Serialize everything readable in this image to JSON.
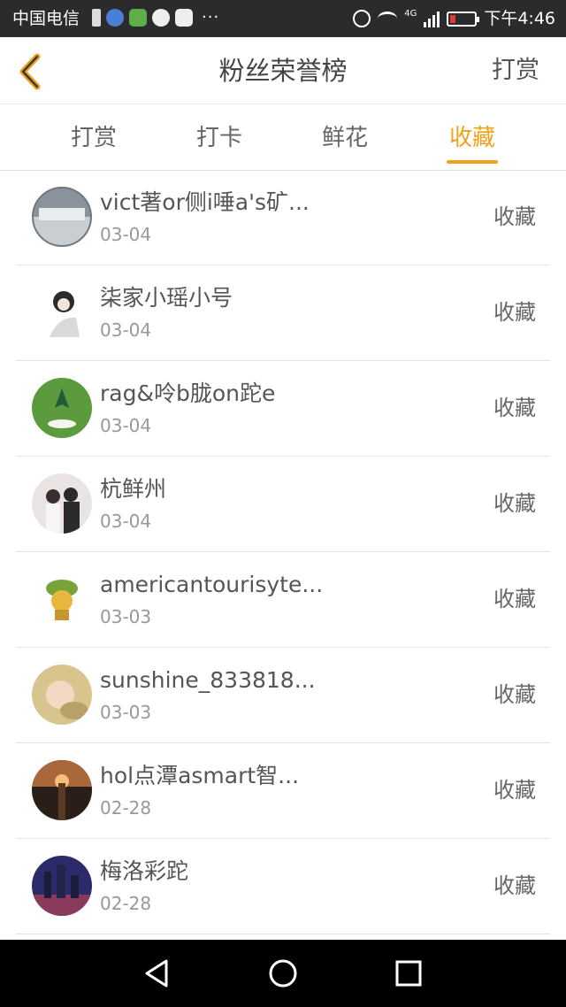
{
  "status_bar": {
    "carrier": "中国电信",
    "more": "···",
    "network": "4G",
    "time": "下午4:46"
  },
  "header": {
    "title": "粉丝荣誉榜",
    "action": "打赏",
    "accent_color": "#f0a11d"
  },
  "tabs": [
    {
      "label": "打赏",
      "active": false
    },
    {
      "label": "打卡",
      "active": false
    },
    {
      "label": "鲜花",
      "active": false
    },
    {
      "label": "收藏",
      "active": true
    }
  ],
  "rows": [
    {
      "name": "vict著or侧i唾a's矿...",
      "date": "03-04",
      "action": "收藏"
    },
    {
      "name": "柒家小瑶小号",
      "date": "03-04",
      "action": "收藏"
    },
    {
      "name": "rag&呤b胧on跎e",
      "date": "03-04",
      "action": "收藏"
    },
    {
      "name": "杭鲜州",
      "date": "03-04",
      "action": "收藏"
    },
    {
      "name": "americantourisyte...",
      "date": "03-03",
      "action": "收藏"
    },
    {
      "name": "sunshine_833818...",
      "date": "03-03",
      "action": "收藏"
    },
    {
      "name": "hol点潭asmart智...",
      "date": "02-28",
      "action": "收藏"
    },
    {
      "name": "梅洛彩跎",
      "date": "02-28",
      "action": "收藏"
    }
  ],
  "nav": [
    "back-triangle-icon",
    "home-circle-icon",
    "recents-square-icon"
  ]
}
